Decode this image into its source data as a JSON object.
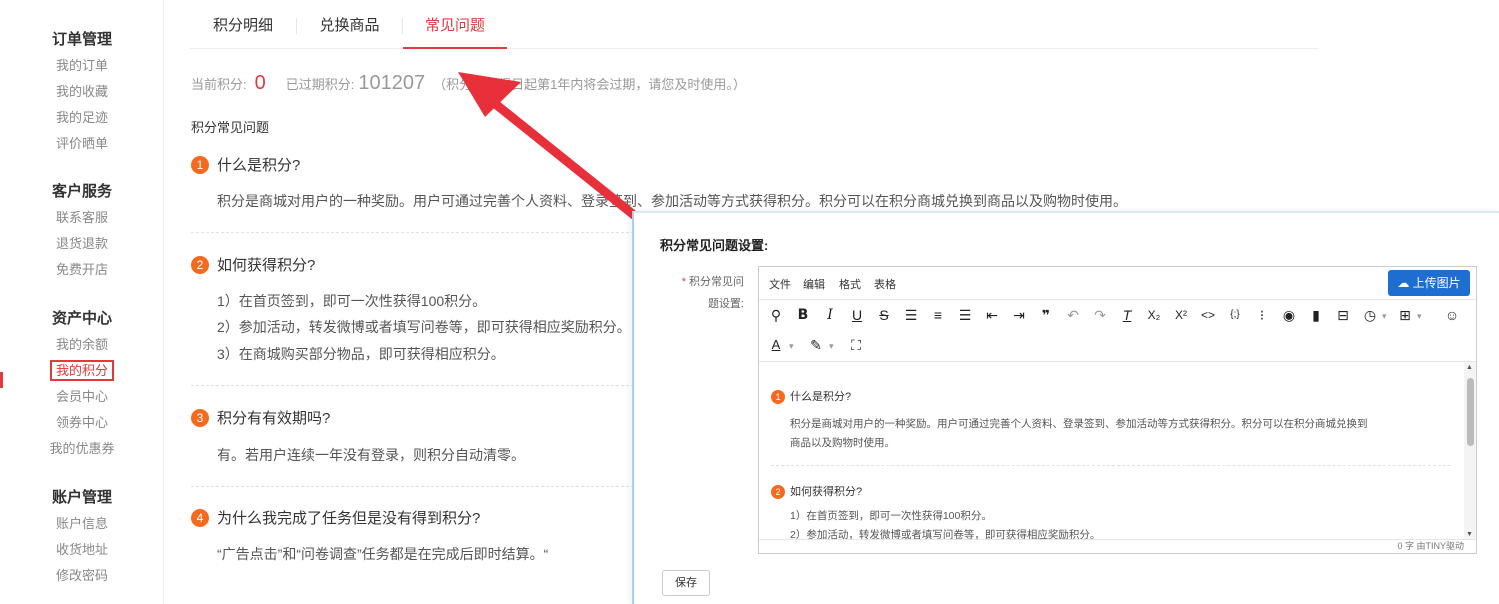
{
  "sidebar": {
    "groups": [
      {
        "title": "订单管理",
        "items": [
          "我的订单",
          "我的收藏",
          "我的足迹",
          "评价晒单"
        ]
      },
      {
        "title": "客户服务",
        "items": [
          "联系客服",
          "退货退款",
          "免费开店"
        ]
      },
      {
        "title": "资产中心",
        "items": [
          "我的余额",
          "我的积分",
          "会员中心",
          "领券中心",
          "我的优惠券"
        ]
      },
      {
        "title": "账户管理",
        "items": [
          "账户信息",
          "收货地址",
          "修改密码"
        ]
      }
    ],
    "active_item": "我的积分"
  },
  "tabs": [
    {
      "label": "积分明细",
      "active": false
    },
    {
      "label": "兑换商品",
      "active": false
    },
    {
      "label": "常见问题",
      "active": true
    }
  ],
  "points": {
    "current_label": "当前积分:",
    "current_value": "0",
    "expired_label": "已过期积分:",
    "expired_value": "101207",
    "note": "（积分自获得日起第1年内将会过期，请您及时使用。）"
  },
  "faq": {
    "heading": "积分常见问题",
    "items": [
      {
        "num": "1",
        "question": "什么是积分?",
        "answers": [
          "积分是商城对用户的一种奖励。用户可通过完善个人资料、登录签到、参加活动等方式获得积分。积分可以在积分商城兑换到商品以及购物时使用。"
        ]
      },
      {
        "num": "2",
        "question": "如何获得积分?",
        "answers": [
          "1）在首页签到，即可一次性获得100积分。",
          "2）参加活动，转发微博或者填写问卷等，即可获得相应奖励积分。",
          "3）在商城购买部分物品，即可获得相应积分。"
        ]
      },
      {
        "num": "3",
        "question": "积分有有效期吗?",
        "answers": [
          "有。若用户连续一年没有登录，则积分自动清零。"
        ]
      },
      {
        "num": "4",
        "question": "为什么我完成了任务但是没有得到积分?",
        "answers": [
          "“广告点击”和“问卷调查”任务都是在完成后即时结算。“"
        ]
      }
    ]
  },
  "panel": {
    "title": "积分常见问题设置:",
    "field_label_line1": "积分常见问",
    "field_label_line2": "题设置:",
    "required_mark": "*",
    "menu": [
      "文件",
      "编辑",
      "格式",
      "表格"
    ],
    "upload_label": "上传图片",
    "status": "0 字  由TINY驱动",
    "save_label": "保存",
    "content": [
      {
        "num": "1",
        "question": "什么是积分?",
        "answers": [
          "积分是商城对用户的一种奖励。用户可通过完善个人资料、登录签到、参加活动等方式获得积分。积分可以在积分商城兑换到",
          "商品以及购物时使用。"
        ]
      },
      {
        "num": "2",
        "question": "如何获得积分?",
        "answers": [
          "1）在首页签到，即可一次性获得100积分。",
          "2）参加活动，转发微博或者填写问卷等，即可获得相应奖励积分。"
        ]
      }
    ]
  },
  "colors": {
    "accent": "#e4393c",
    "badge": "#f56a1e",
    "primary": "#1e6ed2"
  }
}
